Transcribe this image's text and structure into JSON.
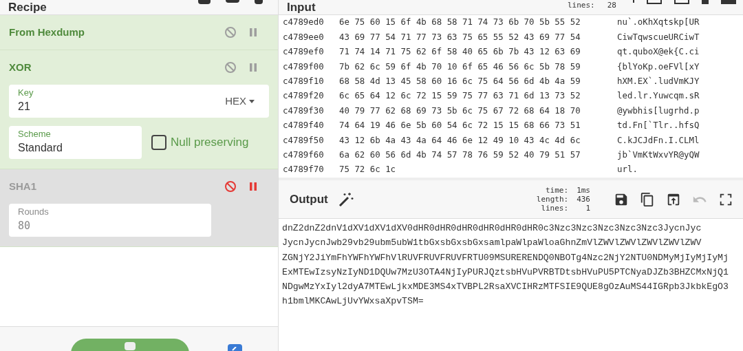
{
  "recipe": {
    "title": "Recipe",
    "operations": [
      {
        "kind": "plain",
        "name": "From Hexdump",
        "disabled": false
      },
      {
        "kind": "xor",
        "name": "XOR",
        "disabled": false,
        "key": {
          "label": "Key",
          "value": "21",
          "encoding": "HEX"
        },
        "scheme": {
          "label": "Scheme",
          "value": "Standard"
        },
        "null_preserving": {
          "label": "Null preserving",
          "checked": false
        }
      },
      {
        "kind": "rounds",
        "name": "SHA1",
        "disabled": true,
        "rounds": {
          "label": "Rounds",
          "value": "80"
        }
      }
    ],
    "auto_bake": {
      "checked": true
    }
  },
  "input": {
    "title": "Input",
    "stats": [
      {
        "label": "lines:",
        "value": "28"
      }
    ],
    "rows": [
      {
        "offset": "c4789ed0",
        "hex": "6e 75 60 15 6f 4b 68 58 71 74 73 6b 70 5b 55 52",
        "ascii": "nu`.oKhXqtskp[UR"
      },
      {
        "offset": "c4789ee0",
        "hex": "43 69 77 54 71 77 73 63 75 65 55 52 43 69 77 54",
        "ascii": "CiwTqwscueURCiwT"
      },
      {
        "offset": "c4789ef0",
        "hex": "71 74 14 71 75 62 6f 58 40 65 6b 7b 43 12 63 69",
        "ascii": "qt.quboX@ek{C.ci"
      },
      {
        "offset": "c4789f00",
        "hex": "7b 62 6c 59 6f 4b 70 10 6f 65 46 56 6c 5b 78 59",
        "ascii": "{blYoKp.oeFVl[xY"
      },
      {
        "offset": "c4789f10",
        "hex": "68 58 4d 13 45 58 60 16 6c 75 64 56 6d 4b 4a 59",
        "ascii": "hXM.EX`.ludVmKJY"
      },
      {
        "offset": "c4789f20",
        "hex": "6c 65 64 12 6c 72 15 59 75 77 63 71 6d 13 73 52",
        "ascii": "led.lr.Yuwcqm.sR"
      },
      {
        "offset": "c4789f30",
        "hex": "40 79 77 62 68 69 73 5b 6c 75 67 72 68 64 18 70",
        "ascii": "@ywbhis[lugrhd.p"
      },
      {
        "offset": "c4789f40",
        "hex": "74 64 19 46 6e 5b 60 54 6c 72 15 15 68 66 73 51",
        "ascii": "td.Fn[`Tlr..hfsQ"
      },
      {
        "offset": "c4789f50",
        "hex": "43 12 6b 4a 43 4a 64 46 6e 12 49 10 43 4c 4d 6c",
        "ascii": "C.kJCJdFn.I.CLMl"
      },
      {
        "offset": "c4789f60",
        "hex": "6a 62 60 56 6d 4b 74 57 78 76 59 52 40 79 51 57",
        "ascii": "jb`VmKtWxvYR@yQW"
      },
      {
        "offset": "c4789f70",
        "hex": "75 72 6c 1c",
        "ascii": "url."
      }
    ]
  },
  "output": {
    "title": "Output",
    "stats": [
      {
        "label": "time:",
        "value": "1ms"
      },
      {
        "label": "length:",
        "value": "436"
      },
      {
        "label": "lines:",
        "value": "1"
      }
    ],
    "lines": [
      "dnZ2dnZ2dnV1dXV1dXV1dXV0dHR0dHR0dHR0dHR0dHR0dHR0c3Nzc3Nzc3Nzc3Nzc3Nzc3JycnJyc",
      "JycnJycnJwb29vb29ubm5ubW1tbGxsbGxsbGxsamlpaWlpaWloaGhnZmVlZWVlZWVlZWVlZWVlZWV",
      "ZGNjY2JiYmFhYWFhYWFhVlRUVFRUVFRUVFRTU09MSURERENDQ0NBOTg4Nzc2NjY2NTU0NDMyMjIyMjIyMj",
      "ExMTEwIzsyNzIyND1DQUw7MzU3OTA4NjIyPURJQztsbHVuPVRBTDtsbHVuPU5PTCNyaDJZb3BHZCMxNjQ1",
      "NDgwMzYxIyl2dyA7MTEwLjkxMDE3MS4xTVBPL2RsaXVCIHRzMTFSIE9QUE8gOzAuMS44IGRpb3JkbkEgO3",
      "h1bmlMKCAwLjUvYWxsaXpvTSM="
    ]
  }
}
